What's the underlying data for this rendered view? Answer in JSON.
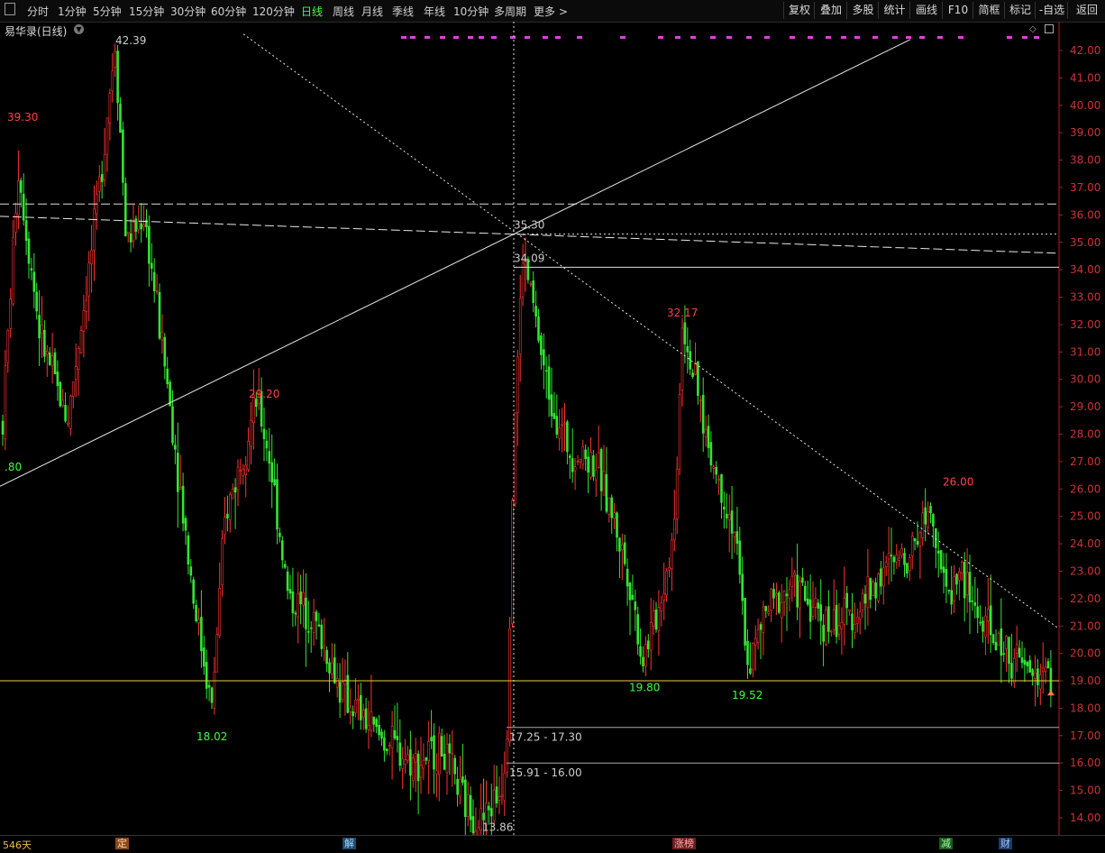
{
  "toolbar": {
    "left_icon": "panel-toggle-icon",
    "periods": [
      "分时",
      "1分钟",
      "5分钟",
      "15分钟",
      "30分钟",
      "60分钟",
      "120分钟",
      "日线",
      "周线",
      "月线",
      "季线",
      "年线",
      "10分钟",
      "多周期",
      "更多 >"
    ],
    "active_period": "日线",
    "right_buttons": [
      "复权",
      "叠加",
      "多股",
      "统计",
      "画线",
      "F10",
      "简框",
      "标记",
      "-自选"
    ],
    "back": "返回"
  },
  "stock_title": "易华录(日线)",
  "bottom": {
    "days": "546天",
    "events": [
      {
        "label": "定",
        "bg": "#8a4a1e",
        "fg": "#ffd0a0"
      },
      {
        "label": "解",
        "bg": "#1e4a6a",
        "fg": "#9fd8ff"
      },
      {
        "label": "涨榜",
        "bg": "#6a1e1e",
        "fg": "#ffb0b0"
      },
      {
        "label": "减",
        "bg": "#1e5a1e",
        "fg": "#a0ffa0"
      },
      {
        "label": "财",
        "bg": "#1e3a6a",
        "fg": "#a0c8ff"
      }
    ]
  },
  "chart_data": {
    "type": "candlestick",
    "ylim": [
      13.5,
      42.6
    ],
    "y_ticks": [
      "42.00",
      "41.00",
      "40.00",
      "39.00",
      "38.00",
      "37.00",
      "36.00",
      "35.00",
      "34.00",
      "33.00",
      "32.00",
      "31.00",
      "30.00",
      "29.00",
      "28.00",
      "27.00",
      "26.00",
      "25.00",
      "24.00",
      "23.00",
      "22.00",
      "21.00",
      "20.00",
      "19.00",
      "18.00",
      "17.00",
      "16.00",
      "15.00",
      "14.00"
    ],
    "price_path": [
      [
        0,
        26.8
      ],
      [
        20,
        37.8
      ],
      [
        45,
        31.5
      ],
      [
        75,
        28.5
      ],
      [
        105,
        35.5
      ],
      [
        128,
        42.39
      ],
      [
        140,
        35.0
      ],
      [
        160,
        36.0
      ],
      [
        185,
        30.0
      ],
      [
        215,
        22.0
      ],
      [
        235,
        18.02
      ],
      [
        250,
        25.0
      ],
      [
        285,
        29.2
      ],
      [
        300,
        27.0
      ],
      [
        320,
        22.0
      ],
      [
        345,
        21.5
      ],
      [
        380,
        18.5
      ],
      [
        420,
        17.0
      ],
      [
        460,
        16.0
      ],
      [
        490,
        16.5
      ],
      [
        515,
        14.5
      ],
      [
        535,
        13.86
      ],
      [
        555,
        15.0
      ],
      [
        562,
        16.5
      ],
      [
        570,
        28.0
      ],
      [
        580,
        34.5
      ],
      [
        590,
        33.0
      ],
      [
        605,
        30.0
      ],
      [
        630,
        27.5
      ],
      [
        660,
        27.0
      ],
      [
        680,
        25.0
      ],
      [
        700,
        22.5
      ],
      [
        712,
        19.8
      ],
      [
        730,
        21.5
      ],
      [
        748,
        24.5
      ],
      [
        757,
        32.17
      ],
      [
        770,
        30.0
      ],
      [
        790,
        27.0
      ],
      [
        815,
        24.5
      ],
      [
        830,
        19.52
      ],
      [
        850,
        21.5
      ],
      [
        880,
        22.5
      ],
      [
        920,
        21.0
      ],
      [
        950,
        21.5
      ],
      [
        980,
        23.0
      ],
      [
        1010,
        23.8
      ],
      [
        1033,
        25.5
      ],
      [
        1050,
        22.0
      ],
      [
        1065,
        23.0
      ],
      [
        1090,
        21.0
      ],
      [
        1120,
        20.0
      ],
      [
        1145,
        19.2
      ],
      [
        1165,
        19.3
      ]
    ],
    "labels": [
      {
        "text": "39.30",
        "x": 22,
        "y": 39.3,
        "color": "#ff4040"
      },
      {
        "text": "42.39",
        "x": 128,
        "y": 42.39,
        "color": "#cccccc"
      },
      {
        "text": "29.20",
        "x": 290,
        "y": 29.2,
        "color": "#ff4040"
      },
      {
        "text": "18.02",
        "x": 232,
        "y": 18.02,
        "color": "#3dff3d"
      },
      {
        "text": "13.86",
        "x": 535,
        "y": 13.86,
        "color": "#cccccc"
      },
      {
        "text": "35.30",
        "x": 570,
        "y": 35.3,
        "color": "#cccccc"
      },
      {
        "text": "34.09",
        "x": 570,
        "y": 34.09,
        "color": "#cccccc"
      },
      {
        "text": "32.17",
        "x": 754,
        "y": 32.17,
        "color": "#ff4040"
      },
      {
        "text": "19.80",
        "x": 712,
        "y": 19.8,
        "color": "#3dff3d"
      },
      {
        "text": "19.52",
        "x": 826,
        "y": 19.52,
        "color": "#3dff3d"
      },
      {
        "text": "26.00",
        "x": 1060,
        "y": 26.0,
        "color": "#ff4040"
      },
      {
        "text": ".80",
        "x": 5,
        "y": 26.8,
        "color": "#3dff3d"
      },
      {
        "text": "17.25 - 17.30",
        "x": 565,
        "y": 17.3,
        "color": "#cccccc"
      },
      {
        "text": "15.91 - 16.00",
        "x": 565,
        "y": 16.0,
        "color": "#cccccc"
      }
    ],
    "hlines": [
      {
        "y": 36.4,
        "style": "dash-long",
        "x0": 0,
        "color": "#dddddd"
      },
      {
        "y": 35.3,
        "style": "dot",
        "x0": 570,
        "color": "#dddddd"
      },
      {
        "y": 34.09,
        "style": "solid",
        "x0": 570,
        "color": "#dddddd"
      },
      {
        "y": 19.0,
        "style": "solid",
        "x0": 0,
        "color": "#e8d040"
      },
      {
        "y": 17.3,
        "style": "solid",
        "x0": 562,
        "color": "#aaaaaa"
      },
      {
        "y": 16.0,
        "style": "solid",
        "x0": 562,
        "color": "#aaaaaa"
      }
    ],
    "trendlines": [
      {
        "x1": 0,
        "y1": 26.1,
        "x2": 1010,
        "y2": 42.4,
        "style": "solid"
      },
      {
        "x1": 270,
        "y1": 42.6,
        "x2": 1175,
        "y2": 20.9,
        "style": "dot"
      },
      {
        "x1": 0,
        "y1": 35.95,
        "x2": 1175,
        "y2": 34.6,
        "style": "dash-long"
      }
    ],
    "crosshair": {
      "x": 570,
      "y": 35.3
    },
    "markers_strip": [
      445,
      455,
      471,
      488,
      503,
      519,
      531,
      545,
      566,
      582,
      602,
      616,
      640,
      688,
      730,
      749,
      766,
      788,
      806,
      828,
      848,
      876,
      896,
      916,
      933,
      948,
      968,
      990,
      1005,
      1020,
      1040,
      1063,
      1117,
      1134,
      1147
    ]
  }
}
